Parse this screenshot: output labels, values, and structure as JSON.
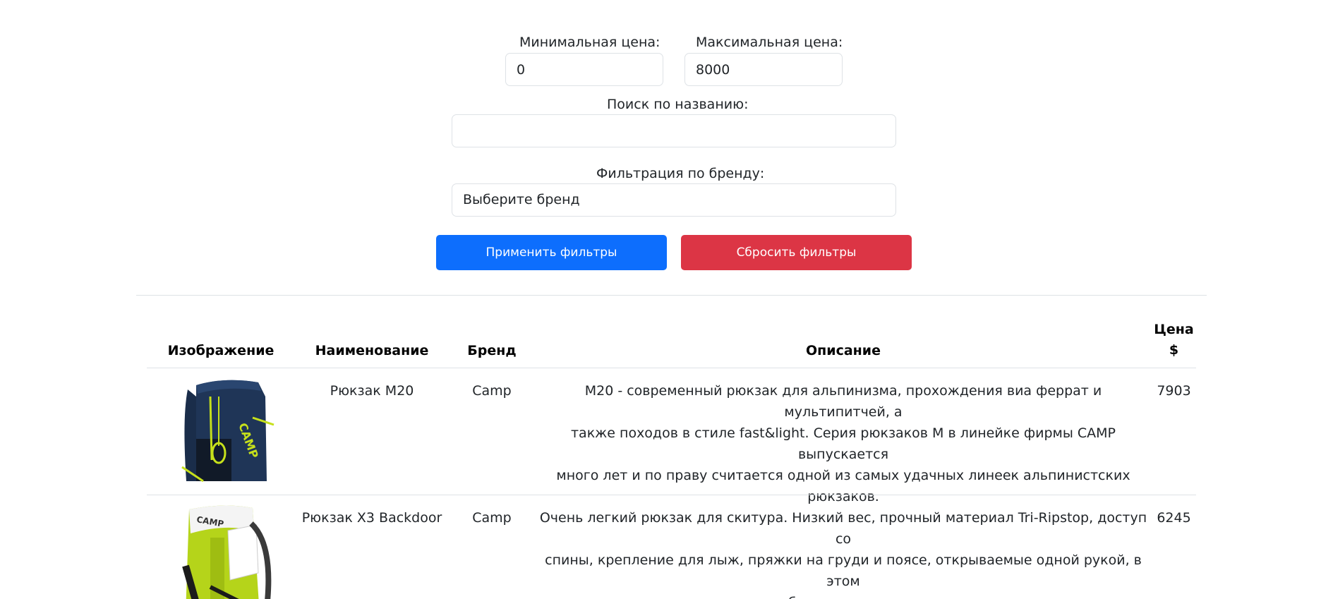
{
  "filters": {
    "min_price_label": "Минимальная цена:",
    "min_price_value": "0",
    "max_price_label": "Максимальная цена:",
    "max_price_value": "8000",
    "search_label": "Поиск по названию:",
    "search_value": "",
    "brand_label": "Фильтрация по бренду:",
    "brand_selected": "Выберите бренд",
    "apply_label": "Применить фильтры",
    "reset_label": "Сбросить фильтры"
  },
  "colors": {
    "primary": "#0d6efd",
    "danger": "#dc3545",
    "border": "#dee2e6"
  },
  "table": {
    "headers": {
      "image": "Изображение",
      "name": "Наименование",
      "brand": "Бренд",
      "description": "Описание",
      "price_line1": "Цена",
      "price_line2": "$"
    },
    "rows": [
      {
        "image_icon": "backpack-camp-navy-image",
        "name": "Рюкзак M20",
        "brand": "Camp",
        "description_lines": [
          "M20 - современный рюкзак для альпинизма, прохождения виа феррат и мультипитчей, а",
          "также походов в стиле fast&light. Серия рюкзаков M в линейке фирмы CAMP выпускается",
          "много лет и по праву считается одной из самых удачных линеек альпинистских рюкзаков."
        ],
        "price": "7903"
      },
      {
        "image_icon": "backpack-camp-lime-image",
        "name": "Рюкзак X3 Backdoor",
        "brand": "Camp",
        "description_lines": [
          "Очень легкий рюкзак для скитура. Низкий вес, прочный материал Tri-Ripstop, доступ со",
          "спины, крепление для лыж, пряжки на груди и поясе, открываемые одной рукой, в этом",
          "рюкзаке есть все, что необходимо для дневного выхода на лыжах."
        ],
        "price": "6245"
      }
    ]
  }
}
